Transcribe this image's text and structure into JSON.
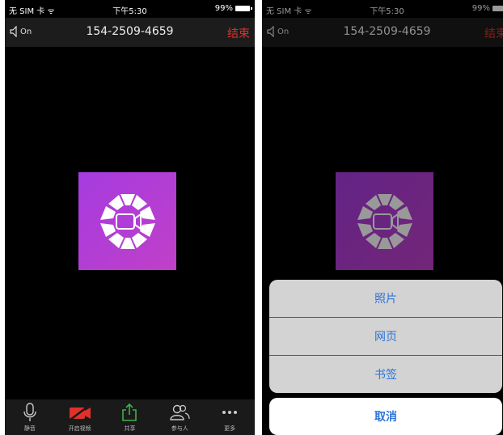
{
  "status_bar": {
    "carrier": "无 SIM 卡 ᯤ",
    "time": "下午5:30",
    "battery": "99%"
  },
  "call_header": {
    "speaker_label": "On",
    "phone_number": "154-2509-4659",
    "end_label": "结束"
  },
  "toolbar": {
    "mute_label": "静音",
    "video_label": "开启视频",
    "share_label": "共享",
    "participants_label": "参与人",
    "more_label": "更多"
  },
  "action_sheet": {
    "items": [
      {
        "label": "照片"
      },
      {
        "label": "网页"
      },
      {
        "label": "书签"
      }
    ],
    "cancel_label": "取消"
  },
  "colors": {
    "accent_blue": "#2d74d9",
    "end_red": "#e0312b",
    "logo_gradient_start": "#a63be0",
    "logo_gradient_end": "#c040c8",
    "share_green": "#3fb04a",
    "video_off_red": "#e0312b"
  },
  "icons": {
    "speaker": "speaker-icon",
    "logo": "zoom-camera-logo",
    "mute": "microphone-icon",
    "video": "video-off-icon",
    "share": "share-icon",
    "participants": "participants-icon",
    "more": "more-dots-icon"
  }
}
